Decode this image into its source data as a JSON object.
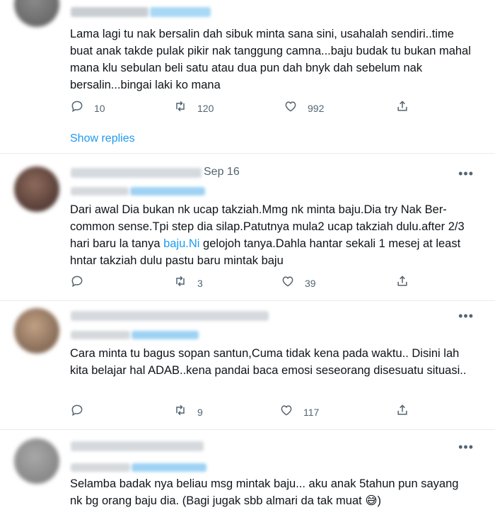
{
  "tweets": [
    {
      "text": "Lama lagi tu nak bersalin dah sibuk minta sana sini, usahalah sendiri..time buat anak takde pulak pikir nak tanggung camna...baju budak tu bukan mahal mana klu sebulan beli satu atau dua pun dah bnyk dah sebelum nak bersalin...bingai laki ko mana",
      "replies": "10",
      "retweets": "120",
      "likes": "992",
      "show_replies": "Show replies"
    },
    {
      "date": "Sep 16",
      "text_before": "Dari awal Dia bukan nk ucap takziah.Mmg nk minta baju.Dia try Nak Ber-common sense.Tpi step dia silap.Patutnya mula2 ucap takziah dulu.after 2/3 hari baru la tanya ",
      "link": "baju.Ni",
      "text_after": " gelojoh tanya.Dahla hantar sekali 1 mesej at least hntar takziah dulu pastu baru mintak baju",
      "replies": "",
      "retweets": "3",
      "likes": "39"
    },
    {
      "text": "Cara minta tu bagus sopan santun,Cuma tidak kena pada waktu.. Disini lah kita belajar hal ADAB..kena pandai baca emosi seseorang disesuatu situasi..",
      "replies": "",
      "retweets": "9",
      "likes": "117"
    },
    {
      "text": "Selamba badak nya beliau msg mintak baju... aku anak 5tahun pun sayang nk bg orang baju dia. (Bagi jugak sbb almari da tak muat 😅)"
    }
  ],
  "more_glyph": "•••",
  "icons": [
    "reply-icon",
    "retweet-icon",
    "like-icon",
    "share-icon",
    "more-icon"
  ],
  "colors": {
    "link": "#1d9bf0",
    "muted": "#536471",
    "divider": "#e6ecf0"
  }
}
